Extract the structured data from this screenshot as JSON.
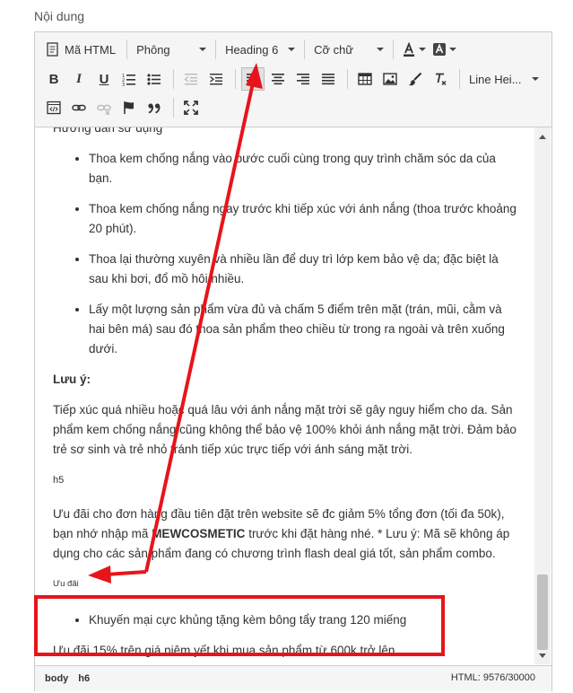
{
  "field_label": "Nội dung",
  "toolbar": {
    "html_btn_label": "Mã HTML",
    "font_select": "Phông",
    "format_select": "Heading 6",
    "size_select": "Cỡ chữ",
    "line_height_select": "Line Hei..."
  },
  "content": {
    "intro_heading": "Hướng dẫn sử dụng",
    "usage_items": [
      "Thoa kem chống nắng vào bước cuối cùng trong quy trình chăm sóc da của bạn.",
      "Thoa kem chống nắng ngay trước khi tiếp xúc với ánh nắng (thoa trước khoảng 20 phút).",
      "Thoa lại thường xuyên và nhiều lần để duy trì lớp kem bảo vệ da; đặc biệt là sau khi bơi, đổ mồ hôi nhiều.",
      "Lấy một lượng sản phẩm vừa đủ và chấm 5 điểm trên mặt (trán, mũi, cằm và hai bên má) sau đó thoa sản phẩm theo chiều từ trong ra ngoài và trên xuống dưới."
    ],
    "note_label": "Lưu ý:",
    "note_text": "Tiếp xúc quá nhiều hoặc quá lâu với ánh nắng mặt trời sẽ gây nguy hiểm cho da. Sản phẩm kem chống nắng cũng không thể bảo vệ 100% khỏi ánh nắng mặt trời. Đảm bảo trẻ sơ sinh và trẻ nhỏ tránh tiếp xúc trực tiếp với ánh sáng mặt trời.",
    "h5_text": "h5",
    "offer_before": "Ưu đãi cho đơn hàng đầu tiên đặt trên website sẽ đc giảm 5% tổng đơn (tối đa 50k), bạn nhớ nhập mã ",
    "offer_code": "MEWCOSMETIC",
    "offer_after": " trước khi đặt hàng nhé. * Lưu ý: Mã sẽ không áp dụng cho các sản phẩm đang có chương trình flash deal giá tốt, sản phẩm combo.",
    "h6_text": "Ưu đãi",
    "promo_item": "Khuyến mại cực khủng tặng kèm bông tẩy trang 120 miếng",
    "promo_text": "Ưu đãi 15% trên giá niêm yết khi mua sản phẩm từ 600k trở lên"
  },
  "statusbar": {
    "path": [
      "body",
      "h6"
    ],
    "counter": "HTML: 9576/30000"
  },
  "colors": {
    "annotation_red": "#e8141b",
    "toolbar_bg": "#f5f5f5",
    "border": "#cccccc"
  }
}
